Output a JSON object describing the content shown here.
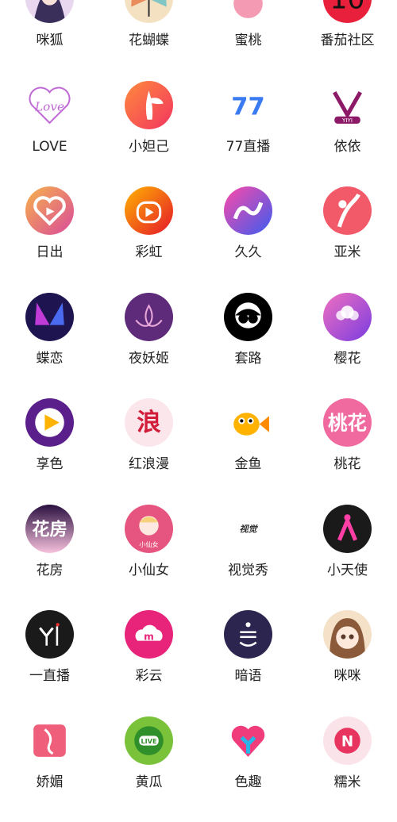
{
  "apps": [
    {
      "label": "咪狐",
      "icon": "fox-girl-icon",
      "color": "#e9d7ef"
    },
    {
      "label": "花蝴蝶",
      "icon": "butterfly-icon",
      "color": "#f3d7b1"
    },
    {
      "label": "蜜桃",
      "icon": "peach-icon",
      "color": "#f49bb3"
    },
    {
      "label": "番茄社区",
      "icon": "tomato-community-icon",
      "color": "#e8203c"
    },
    {
      "label": "LOVE",
      "icon": "love-icon",
      "color": "#c06ad6"
    },
    {
      "label": "小妲己",
      "icon": "fairy-icon",
      "color": "#f5701d"
    },
    {
      "label": "77直播",
      "icon": "77-live-icon",
      "color": "#3a7bf2"
    },
    {
      "label": "依依",
      "icon": "yiyi-icon",
      "color": "#8c1a67"
    },
    {
      "label": "日出",
      "icon": "heart-play-icon",
      "color": "#e85d8a"
    },
    {
      "label": "彩虹",
      "icon": "rainbow-play-icon",
      "color": "#f04a2a"
    },
    {
      "label": "久久",
      "icon": "jiujiu-icon",
      "color": "#7b3cf0"
    },
    {
      "label": "亚米",
      "icon": "dancer-icon",
      "color": "#f25a6a"
    },
    {
      "label": "蝶恋",
      "icon": "butterfly-love-icon",
      "color": "#2a1a63"
    },
    {
      "label": "夜妖姬",
      "icon": "lotus-icon",
      "color": "#5e2a7a"
    },
    {
      "label": "套路",
      "icon": "ape-icon",
      "color": "#000000"
    },
    {
      "label": "樱花",
      "icon": "sakura-icon",
      "color": "#b44fe0"
    },
    {
      "label": "享色",
      "icon": "play-icon",
      "color": "#5a1f8a"
    },
    {
      "label": "红浪漫",
      "icon": "lang-icon",
      "color": "#f7d7df"
    },
    {
      "label": "金鱼",
      "icon": "goldfish-icon",
      "color": "#ffffff"
    },
    {
      "label": "桃花",
      "icon": "peach-blossom-icon",
      "color": "#f06aa0"
    },
    {
      "label": "花房",
      "icon": "flower-house-icon",
      "color": "#6b2363"
    },
    {
      "label": "小仙女",
      "icon": "little-fairy-icon",
      "color": "#e6557f"
    },
    {
      "label": "视觉秀",
      "icon": "visual-show-icon",
      "color": "#ffffff"
    },
    {
      "label": "小天使",
      "icon": "angel-icon",
      "color": "#1a1a1a"
    },
    {
      "label": "一直播",
      "icon": "yi-live-icon",
      "color": "#1a1a1a"
    },
    {
      "label": "彩云",
      "icon": "cloud-icon",
      "color": "#e8247a"
    },
    {
      "label": "暗语",
      "icon": "whisper-icon",
      "color": "#2b2550"
    },
    {
      "label": "咪咪",
      "icon": "anime-girl-icon",
      "color": "#f4e1c8"
    },
    {
      "label": "娇媚",
      "icon": "lady-icon",
      "color": "#ef5f7b"
    },
    {
      "label": "黄瓜",
      "icon": "cucumber-live-icon",
      "color": "#7ac23a"
    },
    {
      "label": "色趣",
      "icon": "heart-y-icon",
      "color": "#f03c7a"
    },
    {
      "label": "糯米",
      "icon": "nuomi-icon",
      "color": "#f5c4d0"
    }
  ]
}
